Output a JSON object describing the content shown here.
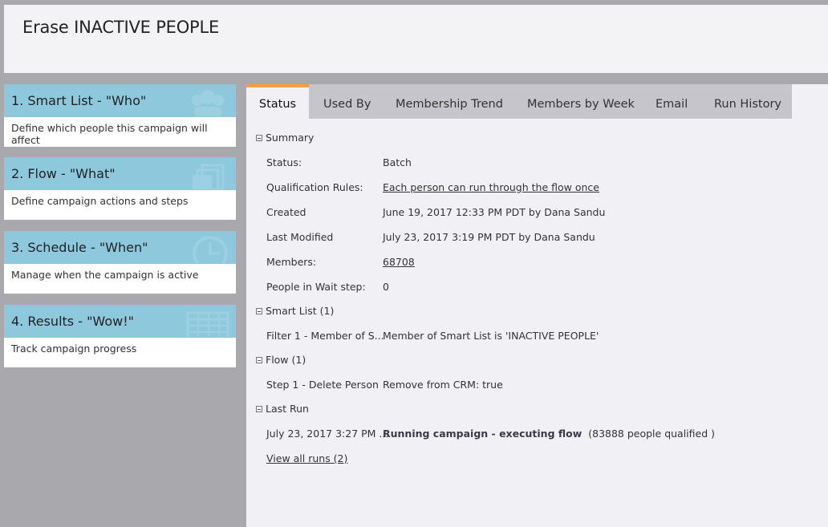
{
  "header": {
    "title": "Erase INACTIVE PEOPLE"
  },
  "cards": [
    {
      "title": "1. Smart List - \"Who\"",
      "desc": "Define which people this campaign will affect",
      "icon": "people-icon"
    },
    {
      "title": "2. Flow - \"What\"",
      "desc": "Define campaign actions and steps",
      "icon": "stacked-pages-icon"
    },
    {
      "title": "3. Schedule - \"When\"",
      "desc": "Manage when the campaign is active",
      "icon": "clock-icon"
    },
    {
      "title": "4. Results - \"Wow!\"",
      "desc": "Track campaign progress",
      "icon": "table-grid-icon"
    }
  ],
  "tabs": [
    {
      "label": "Status",
      "active": true
    },
    {
      "label": "Used By"
    },
    {
      "label": "Membership Trend"
    },
    {
      "label": "Members by Week"
    },
    {
      "label": "Email"
    },
    {
      "label": "Run History"
    }
  ],
  "summary": {
    "heading": "Summary",
    "rows": [
      {
        "label": "Status:",
        "value": "Batch"
      },
      {
        "label": "Qualification Rules:",
        "value": "Each person can run through the flow once"
      },
      {
        "label": "Created",
        "value": "June 19, 2017 12:33 PM PDT by Dana Sandu"
      },
      {
        "label": "Last Modified",
        "value": "July 23, 2017 3:19 PM PDT by Dana Sandu"
      },
      {
        "label": "Members:",
        "value": "68708"
      },
      {
        "label": "People in Wait step:",
        "value": "0"
      }
    ]
  },
  "smart_list": {
    "heading": "Smart List (1)",
    "rows": [
      {
        "label": "Filter 1 - Member of S...",
        "value": "Member of Smart List is 'INACTIVE PEOPLE'"
      }
    ]
  },
  "flow": {
    "heading": "Flow (1)",
    "rows": [
      {
        "label": "Step 1 - Delete Person",
        "value": "Remove from CRM: true"
      }
    ]
  },
  "last_run": {
    "heading": "Last Run",
    "label": "July 23, 2017 3:27 PM ...",
    "status": "Running campaign - executing flow",
    "detail": "(83888 people qualified )",
    "view_all": "View all runs (2)"
  },
  "colors": {
    "card_header": "#8ec8dc",
    "active_tab_accent": "#f0a13c",
    "background": "#a9a9ad"
  }
}
